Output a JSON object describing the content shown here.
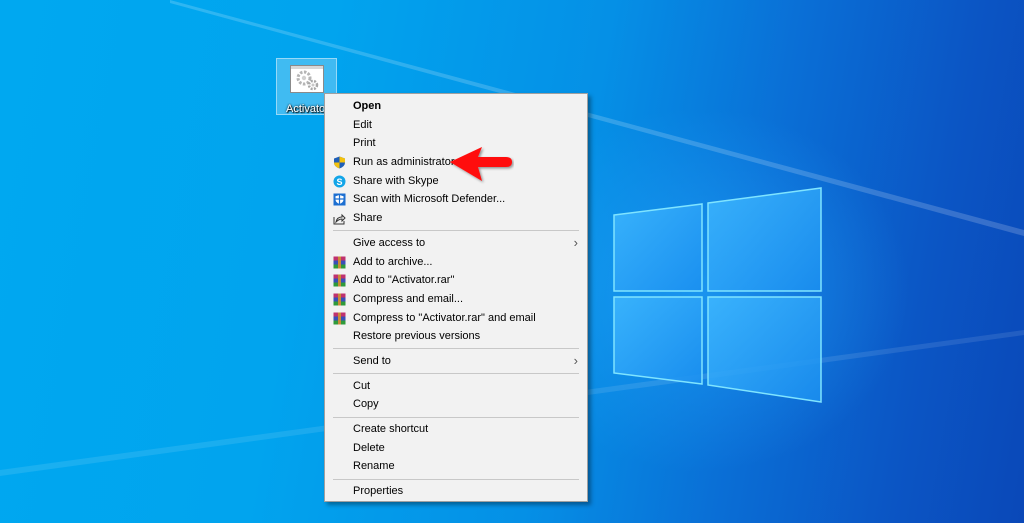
{
  "desktop": {
    "icons": [
      {
        "label": "Activator",
        "icon": "exe-gear-icon",
        "selected": true
      }
    ]
  },
  "context_menu": {
    "sections": [
      [
        {
          "label": "Open",
          "bold": true,
          "icon": null
        },
        {
          "label": "Edit",
          "icon": null
        },
        {
          "label": "Print",
          "icon": null
        },
        {
          "label": "Run as administrator",
          "icon": "uac-shield-icon"
        },
        {
          "label": "Share with Skype",
          "icon": "skype-icon"
        },
        {
          "label": "Scan with Microsoft Defender...",
          "icon": "defender-icon"
        },
        {
          "label": "Share",
          "icon": "share-icon"
        }
      ],
      [
        {
          "label": "Give access to",
          "icon": null,
          "submenu": true
        },
        {
          "label": "Add to archive...",
          "icon": "winrar-icon"
        },
        {
          "label": "Add to \"Activator.rar\"",
          "icon": "winrar-icon"
        },
        {
          "label": "Compress and email...",
          "icon": "winrar-icon"
        },
        {
          "label": "Compress to \"Activator.rar\" and email",
          "icon": "winrar-icon"
        },
        {
          "label": "Restore previous versions",
          "icon": null
        }
      ],
      [
        {
          "label": "Send to",
          "icon": null,
          "submenu": true
        }
      ],
      [
        {
          "label": "Cut",
          "icon": null
        },
        {
          "label": "Copy",
          "icon": null
        }
      ],
      [
        {
          "label": "Create shortcut",
          "icon": null
        },
        {
          "label": "Delete",
          "icon": null
        },
        {
          "label": "Rename",
          "icon": null
        }
      ],
      [
        {
          "label": "Properties",
          "icon": null
        }
      ]
    ],
    "submenu_glyph": "›"
  },
  "annotation": {
    "type": "red-arrow-pointer",
    "points_to": "Run as administrator",
    "color": "#ff0000"
  },
  "colors": {
    "menu_bg": "#f2f2f2",
    "menu_border": "#a0a0a0",
    "separator": "#c8c8c8",
    "desktop_light": "#00a8f0",
    "desktop_dark": "#0a48b8"
  }
}
